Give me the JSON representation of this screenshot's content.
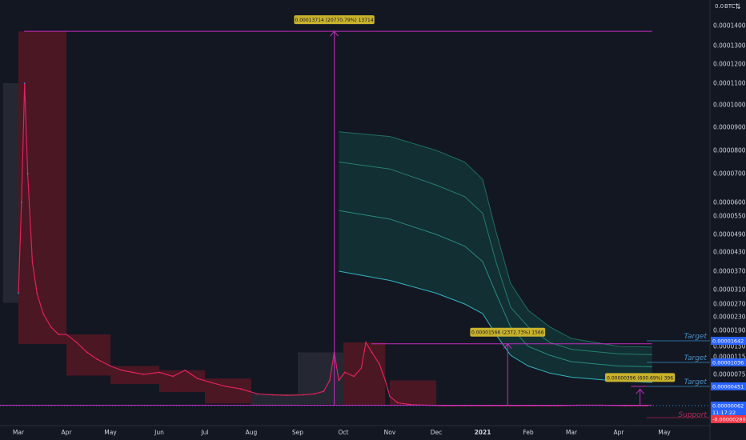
{
  "chart_data": {
    "type": "line",
    "title": "",
    "unit_label": "BTC",
    "unit_prefix": "0.0",
    "y_scale": "log",
    "ylim": [
      1e-07,
      0.00022
    ],
    "xlim": [
      "2020-03-01",
      "2021-05-10"
    ],
    "x_ticks": [
      {
        "date": "2020-03-01",
        "label": "Mar"
      },
      {
        "date": "2020-04-01",
        "label": "Apr"
      },
      {
        "date": "2020-05-01",
        "label": "May"
      },
      {
        "date": "2020-06-01",
        "label": "Jun"
      },
      {
        "date": "2020-07-01",
        "label": "Jul"
      },
      {
        "date": "2020-08-01",
        "label": "Aug"
      },
      {
        "date": "2020-09-01",
        "label": "Sep"
      },
      {
        "date": "2020-10-01",
        "label": "Oct"
      },
      {
        "date": "2020-11-01",
        "label": "Nov"
      },
      {
        "date": "2020-12-01",
        "label": "Dec"
      },
      {
        "date": "2021-01-01",
        "label": "2021"
      },
      {
        "date": "2021-02-01",
        "label": "Feb"
      },
      {
        "date": "2021-03-01",
        "label": "Mar"
      },
      {
        "date": "2021-04-01",
        "label": "Apr"
      },
      {
        "date": "2021-05-01",
        "label": "May"
      }
    ],
    "y_ticks": [
      {
        "value": 0.00014,
        "label": "0.00014000"
      },
      {
        "value": 0.00013,
        "label": "0.00013000"
      },
      {
        "value": 0.00012,
        "label": "0.00012000"
      },
      {
        "value": 0.00011,
        "label": "0.00011000"
      },
      {
        "value": 0.0001,
        "label": "0.00010000"
      },
      {
        "value": 9e-05,
        "label": "0.00009000"
      },
      {
        "value": 8e-05,
        "label": "0.00008000"
      },
      {
        "value": 7e-05,
        "label": "0.00007000"
      },
      {
        "value": 6e-05,
        "label": "0.00006000"
      },
      {
        "value": 5.5e-05,
        "label": "0.00005500"
      },
      {
        "value": 4.9e-05,
        "label": "0.00004900"
      },
      {
        "value": 4.3e-05,
        "label": "0.00004300"
      },
      {
        "value": 3.7e-05,
        "label": "0.00003700"
      },
      {
        "value": 3.1e-05,
        "label": "0.00003100"
      },
      {
        "value": 2.7e-05,
        "label": "0.00002700"
      },
      {
        "value": 2.3e-05,
        "label": "0.00002300"
      },
      {
        "value": 1.9e-05,
        "label": "0.00001900"
      },
      {
        "value": 1.5e-05,
        "label": "0.00001500"
      },
      {
        "value": 1.15e-05,
        "label": "0.00001150"
      },
      {
        "value": 7.5e-06,
        "label": "0.00000750"
      }
    ],
    "price_series": {
      "dates": [
        "2020-03-01",
        "2020-03-03",
        "2020-03-05",
        "2020-03-07",
        "2020-03-10",
        "2020-03-13",
        "2020-03-17",
        "2020-03-22",
        "2020-03-27",
        "2020-04-01",
        "2020-04-08",
        "2020-04-15",
        "2020-04-22",
        "2020-05-01",
        "2020-05-08",
        "2020-05-15",
        "2020-05-22",
        "2020-06-01",
        "2020-06-10",
        "2020-06-18",
        "2020-06-26",
        "2020-07-05",
        "2020-07-15",
        "2020-07-25",
        "2020-08-05",
        "2020-08-15",
        "2020-08-25",
        "2020-09-05",
        "2020-09-12",
        "2020-09-18",
        "2020-09-22",
        "2020-09-25",
        "2020-09-28",
        "2020-10-02",
        "2020-10-08",
        "2020-10-13",
        "2020-10-16",
        "2020-10-20",
        "2020-10-25",
        "2020-10-29",
        "2020-11-01",
        "2020-11-06",
        "2020-11-15",
        "2020-11-25",
        "2020-12-05",
        "2020-12-20",
        "2021-01-05",
        "2021-01-20",
        "2021-02-05",
        "2021-02-20",
        "2021-03-05",
        "2021-03-20",
        "2021-04-05",
        "2021-04-20"
      ],
      "values": [
        3e-05,
        6e-05,
        0.00011,
        7e-05,
        4e-05,
        3e-05,
        2.4e-05,
        2e-05,
        1.8e-05,
        1.8e-05,
        1.6e-05,
        1.3e-05,
        1.1e-05,
        9.5e-06,
        8.5e-06,
        8e-06,
        7.5e-06,
        8e-06,
        7e-06,
        8.5e-06,
        6.5e-06,
        5.5e-06,
        4.5e-06,
        4e-06,
        3e-06,
        2.8e-06,
        2.7e-06,
        2.8e-06,
        3e-06,
        3.5e-06,
        6e-06,
        1.3e-05,
        6e-06,
        8e-06,
        7e-06,
        9e-06,
        1.6e-05,
        1.3e-05,
        1e-05,
        6e-06,
        2.5e-06,
        1.2e-06,
        8e-07,
        7e-07,
        6e-07,
        6e-07,
        6e-07,
        6e-07,
        6e-07,
        6e-07,
        7e-07,
        7e-07,
        6e-07,
        6e-07
      ]
    },
    "projection_band": {
      "dates": [
        "2020-09-28",
        "2020-11-01",
        "2020-12-01",
        "2020-12-20",
        "2021-01-01",
        "2021-01-10",
        "2021-01-20",
        "2021-02-01",
        "2021-02-15",
        "2021-03-01",
        "2021-04-01",
        "2021-04-23"
      ],
      "upper": [
        8.8e-05,
        8.6e-05,
        8e-05,
        7.5e-05,
        6.8e-05,
        5e-05,
        3.3e-05,
        2.5e-05,
        2e-05,
        1.7e-05,
        1.5e-05,
        1.48e-05
      ],
      "upper_mid": [
        7.5e-05,
        7.2e-05,
        6.6e-05,
        6.2e-05,
        5.6e-05,
        4e-05,
        2.6e-05,
        2e-05,
        1.6e-05,
        1.4e-05,
        1.25e-05,
        1.22e-05
      ],
      "middle": [
        5.7e-05,
        5.4e-05,
        4.9e-05,
        4.5e-05,
        4e-05,
        3e-05,
        2e-05,
        1.5e-05,
        1.2e-05,
        1.05e-05,
        9.5e-06,
        9.3e-06
      ],
      "lower": [
        3.7e-05,
        3.4e-05,
        3e-05,
        2.7e-05,
        2.4e-05,
        1.8e-05,
        1.2e-05,
        9.5e-06,
        7.8e-06,
        6.8e-06,
        5.8e-06,
        5.5e-06
      ]
    },
    "zones": [
      {
        "from": "2020-02-20",
        "to": "2020-03-01",
        "kind": "gray"
      },
      {
        "from": "2020-03-01",
        "to": "2020-04-01",
        "kind": "red"
      },
      {
        "from": "2020-04-01",
        "to": "2020-05-01",
        "kind": "red"
      },
      {
        "from": "2020-05-01",
        "to": "2020-06-01",
        "kind": "red"
      },
      {
        "from": "2020-06-01",
        "to": "2020-07-01",
        "kind": "red"
      },
      {
        "from": "2020-07-01",
        "to": "2020-08-01",
        "kind": "red"
      },
      {
        "from": "2020-08-01",
        "to": "2020-09-01",
        "kind": "gray"
      },
      {
        "from": "2020-09-01",
        "to": "2020-10-01",
        "kind": "gray"
      },
      {
        "from": "2020-10-01",
        "to": "2020-10-29",
        "kind": "red"
      },
      {
        "from": "2020-11-01",
        "to": "2020-12-01",
        "kind": "red"
      }
    ],
    "measurements": [
      {
        "label": "0.00013714 (20770.79%) 13714",
        "date": "2020-09-25",
        "from": 6.2e-07,
        "to": 0.00013714
      },
      {
        "label": "0.00001566 (2372.73%) 1566",
        "date": "2021-01-18",
        "from": 6.2e-07,
        "to": 1.566e-05
      },
      {
        "label": "0.00000396 (600.69%) 396",
        "date": "2021-04-15",
        "from": 6.2e-07,
        "to": 3.96e-06
      }
    ],
    "targets": [
      {
        "label": "Target",
        "value": 1.642e-05,
        "badge": "0.00001642"
      },
      {
        "label": "Target",
        "value": 1.036e-05,
        "badge": "0.00001036"
      },
      {
        "label": "Target",
        "value": 4.51e-06,
        "badge": "0.00000451"
      }
    ],
    "support": {
      "label": "Support",
      "value": -2.8e-06,
      "badge": "-0.00000280"
    },
    "current_price": {
      "value": 6.2e-07,
      "badge": "0.00000062",
      "countdown": "11:17:22"
    },
    "ath_line": 0.00013714,
    "grid": false,
    "legend": "none"
  }
}
